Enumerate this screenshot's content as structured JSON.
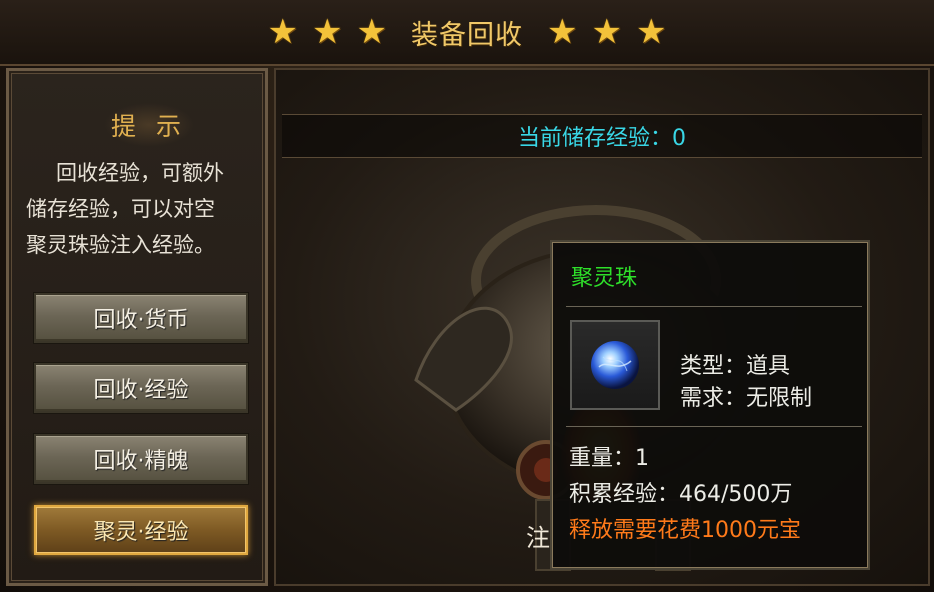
{
  "window": {
    "title": "装备回收",
    "title_star_icon": "star-icon",
    "title_star_color": "#f3c23a"
  },
  "tip": {
    "heading": "提 示",
    "lines": [
      "回收经验，可额外",
      "储存经验，可以对空",
      "聚灵珠验注入经验。"
    ]
  },
  "menu": {
    "items": [
      {
        "label": "回收·货币",
        "active": false
      },
      {
        "label": "回收·经验",
        "active": false
      },
      {
        "label": "回收·精魄",
        "active": false
      },
      {
        "label": "聚灵·经验",
        "active": true
      }
    ]
  },
  "main": {
    "stored_exp_label": "当前储存经验：0",
    "inject_button_partial": "注"
  },
  "tooltip": {
    "item_name": "聚灵珠",
    "item_icon": "blue-orb-icon",
    "type_line": "类型：道具",
    "requirement_line": "需求：无限制",
    "weight_line": "重量：1",
    "accumulated_exp_line": "积累经验：464/500万",
    "release_cost_line": "释放需要花费1000元宝",
    "colors": {
      "name": "#2ee02a",
      "warning": "#ff7a1a"
    }
  }
}
